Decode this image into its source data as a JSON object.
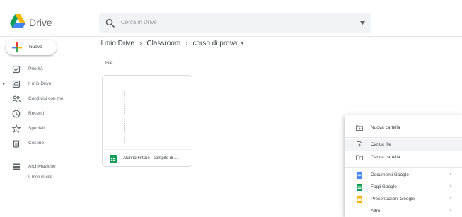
{
  "header": {
    "app_title": "Drive",
    "search_placeholder": "Cerca in Drive"
  },
  "sidebar": {
    "new_button_label": "Nuovo",
    "items": [
      {
        "label": "Priorità",
        "icon": "checkbox-icon"
      },
      {
        "label": "Il mio Drive",
        "icon": "my-drive-icon"
      },
      {
        "label": "Condivisi con me",
        "icon": "shared-people-icon"
      },
      {
        "label": "Recenti",
        "icon": "clock-icon"
      },
      {
        "label": "Speciali",
        "icon": "star-icon"
      },
      {
        "label": "Cestino",
        "icon": "trash-icon"
      },
      {
        "label": "Archiviazione",
        "icon": "storage-icon"
      }
    ],
    "storage_text": "0 byte in uso"
  },
  "breadcrumb": [
    "Il mio Drive",
    "Classroom",
    "corso di prova"
  ],
  "main": {
    "files_heading": "File",
    "files": [
      {
        "name": "Alunno Fittizio - compito di ...",
        "icon": "google-sheets-icon"
      }
    ]
  },
  "context_menu": {
    "items": [
      {
        "label": "Nuova cartella",
        "icon": "new-folder-icon"
      },
      {
        "label": "Carica file",
        "icon": "upload-file-icon"
      },
      {
        "label": "Carica cartella...",
        "icon": "upload-folder-icon"
      },
      {
        "label": "Documenti Google",
        "icon": "google-docs-icon"
      },
      {
        "label": "Fogli Google",
        "icon": "google-sheets-icon"
      },
      {
        "label": "Presentazioni Google",
        "icon": "google-slides-icon"
      },
      {
        "label": "Altro",
        "icon": "more-icon"
      }
    ]
  },
  "colors": {
    "docs_blue": "#4285f4",
    "sheets_green": "#0f9d58",
    "slides_yellow": "#f4b400",
    "search_bg": "#f1f3f4"
  }
}
